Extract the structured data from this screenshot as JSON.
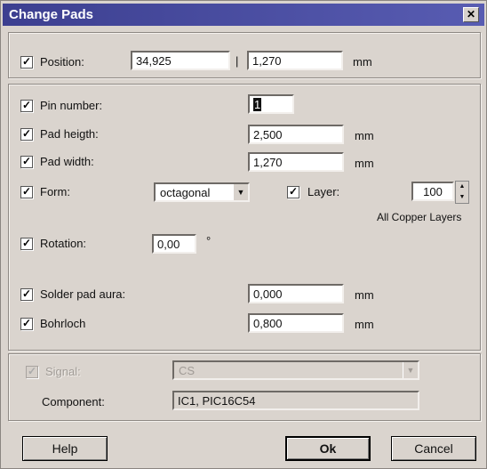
{
  "window": {
    "title": "Change Pads",
    "close_glyph": "✕"
  },
  "check_mark": "✓",
  "position": {
    "label": "Position:",
    "x": "34,925",
    "separator": "|",
    "y": "1,270",
    "unit": "mm"
  },
  "pin_number": {
    "label": "Pin number:",
    "value": "1"
  },
  "pad_height": {
    "label": "Pad heigth:",
    "value": "2,500",
    "unit": "mm"
  },
  "pad_width": {
    "label": "Pad width:",
    "value": "1,270",
    "unit": "mm"
  },
  "form": {
    "label": "Form:",
    "value": "octagonal",
    "arrow": "▼"
  },
  "layer": {
    "label": "Layer:",
    "value": "100",
    "caption": "All Copper Layers",
    "up": "▲",
    "down": "▼"
  },
  "rotation": {
    "label": "Rotation:",
    "value": "0,00",
    "unit": "°"
  },
  "solder_pad_aura": {
    "label": "Solder pad aura:",
    "value": "0,000",
    "unit": "mm"
  },
  "bohrloch": {
    "label": "Bohrloch",
    "value": "0,800",
    "unit": "mm"
  },
  "signal": {
    "label": "Signal:",
    "value": "CS",
    "arrow": "▼"
  },
  "component": {
    "label": "Component:",
    "value": "IC1, PIC16C54"
  },
  "buttons": {
    "help": "Help",
    "ok": "Ok",
    "cancel": "Cancel"
  },
  "colors": {
    "titlebar": "#3c3f90",
    "face": "#dad4ce"
  }
}
